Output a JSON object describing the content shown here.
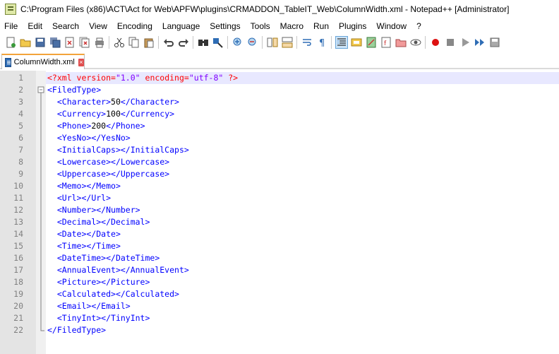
{
  "window": {
    "title": "C:\\Program Files (x86)\\ACT\\Act for Web\\APFW\\plugins\\CRMADDON_TableIT_Web\\ColumnWidth.xml - Notepad++ [Administrator]"
  },
  "menu": [
    "File",
    "Edit",
    "Search",
    "View",
    "Encoding",
    "Language",
    "Settings",
    "Tools",
    "Macro",
    "Run",
    "Plugins",
    "Window",
    "?"
  ],
  "toolbar": {
    "buttons": [
      "new-file-icon",
      "open-file-icon",
      "save-icon",
      "save-all-icon",
      "close-icon",
      "close-all-icon",
      "print-icon",
      "cut-icon",
      "copy-icon",
      "paste-icon",
      "undo-icon",
      "redo-icon",
      "find-icon",
      "replace-icon",
      "zoom-in-icon",
      "zoom-out-icon",
      "sync-vertical-icon",
      "sync-horizontal-icon",
      "word-wrap-icon",
      "show-all-chars-icon",
      "indent-guide-icon",
      "language-define-icon",
      "document-map-icon",
      "function-list-icon",
      "folder-workspace-icon",
      "monitoring-icon",
      "record-macro-icon",
      "stop-macro-icon",
      "play-macro-icon",
      "run-macro-multiple-icon",
      "save-macro-icon"
    ],
    "active": "indent-guide-icon"
  },
  "tabs": [
    {
      "label": "ColumnWidth.xml",
      "icon": "xml-file-icon"
    }
  ],
  "editor": {
    "current_line": 1,
    "lines": [
      {
        "num": "1",
        "fold": "none",
        "segs": [
          [
            "decl",
            "<?xml "
          ],
          [
            "attr",
            "version"
          ],
          [
            "decl",
            "="
          ],
          [
            "val",
            "\"1.0\""
          ],
          [
            "decl",
            " "
          ],
          [
            "attr",
            "encoding"
          ],
          [
            "decl",
            "="
          ],
          [
            "val",
            "\"utf-8\""
          ],
          [
            "decl",
            " ?>"
          ]
        ]
      },
      {
        "num": "2",
        "fold": "open",
        "segs": [
          [
            "tag",
            "<FiledType>"
          ]
        ]
      },
      {
        "num": "3",
        "fold": "line",
        "segs": [
          [
            "txt",
            "  "
          ],
          [
            "tag",
            "<Character>"
          ],
          [
            "txt",
            "50"
          ],
          [
            "tag",
            "</Character>"
          ]
        ]
      },
      {
        "num": "4",
        "fold": "line",
        "segs": [
          [
            "txt",
            "  "
          ],
          [
            "tag",
            "<Currency>"
          ],
          [
            "txt",
            "100"
          ],
          [
            "tag",
            "</Currency>"
          ]
        ]
      },
      {
        "num": "5",
        "fold": "line",
        "segs": [
          [
            "txt",
            "  "
          ],
          [
            "tag",
            "<Phone>"
          ],
          [
            "txt",
            "200"
          ],
          [
            "tag",
            "</Phone>"
          ]
        ]
      },
      {
        "num": "6",
        "fold": "line",
        "segs": [
          [
            "txt",
            "  "
          ],
          [
            "tag",
            "<YesNo></YesNo>"
          ]
        ]
      },
      {
        "num": "7",
        "fold": "line",
        "segs": [
          [
            "txt",
            "  "
          ],
          [
            "tag",
            "<InitialCaps></InitialCaps>"
          ]
        ]
      },
      {
        "num": "8",
        "fold": "line",
        "segs": [
          [
            "txt",
            "  "
          ],
          [
            "tag",
            "<Lowercase></Lowercase>"
          ]
        ]
      },
      {
        "num": "9",
        "fold": "line",
        "segs": [
          [
            "txt",
            "  "
          ],
          [
            "tag",
            "<Uppercase></Uppercase>"
          ]
        ]
      },
      {
        "num": "10",
        "fold": "line",
        "segs": [
          [
            "txt",
            "  "
          ],
          [
            "tag",
            "<Memo></Memo>"
          ]
        ]
      },
      {
        "num": "11",
        "fold": "line",
        "segs": [
          [
            "txt",
            "  "
          ],
          [
            "tag",
            "<Url></Url>"
          ]
        ]
      },
      {
        "num": "12",
        "fold": "line",
        "segs": [
          [
            "txt",
            "  "
          ],
          [
            "tag",
            "<Number></Number>"
          ]
        ]
      },
      {
        "num": "13",
        "fold": "line",
        "segs": [
          [
            "txt",
            "  "
          ],
          [
            "tag",
            "<Decimal></Decimal>"
          ]
        ]
      },
      {
        "num": "14",
        "fold": "line",
        "segs": [
          [
            "txt",
            "  "
          ],
          [
            "tag",
            "<Date></Date>"
          ]
        ]
      },
      {
        "num": "15",
        "fold": "line",
        "segs": [
          [
            "txt",
            "  "
          ],
          [
            "tag",
            "<Time></Time>"
          ]
        ]
      },
      {
        "num": "16",
        "fold": "line",
        "segs": [
          [
            "txt",
            "  "
          ],
          [
            "tag",
            "<DateTime></DateTime>"
          ]
        ]
      },
      {
        "num": "17",
        "fold": "line",
        "segs": [
          [
            "txt",
            "  "
          ],
          [
            "tag",
            "<AnnualEvent></AnnualEvent>"
          ]
        ]
      },
      {
        "num": "18",
        "fold": "line",
        "segs": [
          [
            "txt",
            "  "
          ],
          [
            "tag",
            "<Picture></Picture>"
          ]
        ]
      },
      {
        "num": "19",
        "fold": "line",
        "segs": [
          [
            "txt",
            "  "
          ],
          [
            "tag",
            "<Calculated></Calculated>"
          ]
        ]
      },
      {
        "num": "20",
        "fold": "line",
        "segs": [
          [
            "txt",
            "  "
          ],
          [
            "tag",
            "<Email></Email>"
          ]
        ]
      },
      {
        "num": "21",
        "fold": "line",
        "segs": [
          [
            "txt",
            "  "
          ],
          [
            "tag",
            "<TinyInt></TinyInt>"
          ]
        ]
      },
      {
        "num": "22",
        "fold": "end",
        "segs": [
          [
            "tag",
            "</FiledType>"
          ]
        ]
      }
    ]
  },
  "colors": {
    "tag": "#0000ff",
    "text": "#000000",
    "declaration": "#ff0000",
    "attribute": "#ff0000",
    "attribute_value": "#8000ff",
    "current_line": "#e8e8ff",
    "active_tab_accent": "#f3a33a"
  }
}
